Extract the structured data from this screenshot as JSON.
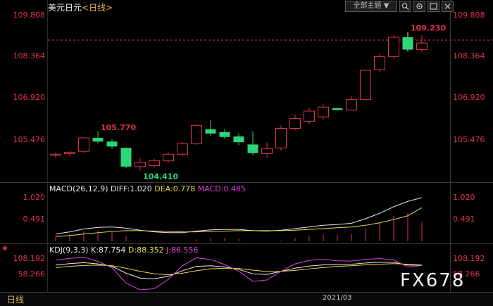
{
  "header": {
    "symbol": "美元日元",
    "period": "<日线>",
    "theme_button": "全部主题",
    "theme_arrow": "▼",
    "icons": [
      "search-icon",
      "settings-icon",
      "fullscreen-icon",
      "close-icon"
    ]
  },
  "footer": {
    "period_tab": "日线",
    "date_label": "2021/03",
    "watermark": "FX678"
  },
  "chart_data": [
    {
      "type": "candlestick",
      "title": "美元日元<日线>",
      "ylim": [
        104.0,
        110.2
      ],
      "yticks": [
        "109.808",
        "108.364",
        "106.920",
        "105.476"
      ],
      "ytick_values": [
        109.808,
        108.364,
        106.92,
        105.476
      ],
      "reference_line": 108.95,
      "annotations": [
        {
          "text": "109.230",
          "value": 109.23,
          "index": 25
        },
        {
          "text": "105.770",
          "value": 105.77,
          "index": 3
        },
        {
          "text": "104.410",
          "value": 104.41,
          "index": 6
        }
      ],
      "candles": [
        {
          "o": 104.95,
          "h": 105.05,
          "l": 104.85,
          "c": 104.98
        },
        {
          "o": 105.0,
          "h": 105.08,
          "l": 104.92,
          "c": 105.05
        },
        {
          "o": 105.08,
          "h": 105.55,
          "l": 105.02,
          "c": 105.55
        },
        {
          "o": 105.55,
          "h": 105.77,
          "l": 105.35,
          "c": 105.42
        },
        {
          "o": 105.42,
          "h": 105.5,
          "l": 105.18,
          "c": 105.25
        },
        {
          "o": 105.2,
          "h": 105.22,
          "l": 104.5,
          "c": 104.55
        },
        {
          "o": 104.55,
          "h": 104.85,
          "l": 104.41,
          "c": 104.7
        },
        {
          "o": 104.58,
          "h": 104.82,
          "l": 104.52,
          "c": 104.75
        },
        {
          "o": 104.75,
          "h": 105.05,
          "l": 104.68,
          "c": 104.98
        },
        {
          "o": 104.98,
          "h": 105.4,
          "l": 104.92,
          "c": 105.35
        },
        {
          "o": 105.35,
          "h": 106.02,
          "l": 105.3,
          "c": 105.98
        },
        {
          "o": 105.85,
          "h": 106.18,
          "l": 105.62,
          "c": 105.7
        },
        {
          "o": 105.75,
          "h": 105.85,
          "l": 105.5,
          "c": 105.58
        },
        {
          "o": 105.6,
          "h": 105.7,
          "l": 105.3,
          "c": 105.4
        },
        {
          "o": 105.32,
          "h": 105.78,
          "l": 104.95,
          "c": 105.02
        },
        {
          "o": 105.0,
          "h": 105.4,
          "l": 104.88,
          "c": 105.18
        },
        {
          "o": 105.2,
          "h": 105.98,
          "l": 105.12,
          "c": 105.88
        },
        {
          "o": 105.88,
          "h": 106.35,
          "l": 105.82,
          "c": 106.22
        },
        {
          "o": 106.12,
          "h": 106.6,
          "l": 106.02,
          "c": 106.48
        },
        {
          "o": 106.28,
          "h": 106.72,
          "l": 106.18,
          "c": 106.62
        },
        {
          "o": 106.58,
          "h": 106.6,
          "l": 106.5,
          "c": 106.52
        },
        {
          "o": 106.52,
          "h": 107.0,
          "l": 106.5,
          "c": 106.88
        },
        {
          "o": 106.88,
          "h": 107.92,
          "l": 106.85,
          "c": 107.9
        },
        {
          "o": 107.92,
          "h": 108.48,
          "l": 107.82,
          "c": 108.38
        },
        {
          "o": 108.38,
          "h": 109.12,
          "l": 108.3,
          "c": 109.05
        },
        {
          "o": 109.05,
          "h": 109.23,
          "l": 108.55,
          "c": 108.62
        },
        {
          "o": 108.62,
          "h": 109.12,
          "l": 108.55,
          "c": 108.85
        }
      ]
    },
    {
      "type": "line",
      "title": "MACD(26,12,9)",
      "legend": [
        {
          "label": "DIFF:1.020",
          "color": "#e8e8e8"
        },
        {
          "label": "DEA:0.778",
          "color": "#e8d84a"
        },
        {
          "label": "MACD:0.485",
          "color": "#e040e0"
        }
      ],
      "ylim": [
        0.0,
        1.1
      ],
      "yticks": [
        "1.020",
        "0.491"
      ],
      "ytick_values": [
        1.02,
        0.491
      ],
      "series": [
        {
          "name": "DIFF",
          "color": "#e8e8e8",
          "values": [
            0.14,
            0.19,
            0.26,
            0.3,
            0.31,
            0.28,
            0.23,
            0.19,
            0.17,
            0.17,
            0.21,
            0.24,
            0.25,
            0.25,
            0.22,
            0.21,
            0.23,
            0.27,
            0.31,
            0.35,
            0.37,
            0.4,
            0.51,
            0.64,
            0.8,
            0.93,
            1.02
          ]
        },
        {
          "name": "DEA",
          "color": "#e8d84a",
          "values": [
            0.08,
            0.1,
            0.14,
            0.17,
            0.2,
            0.22,
            0.22,
            0.21,
            0.2,
            0.19,
            0.19,
            0.2,
            0.21,
            0.22,
            0.22,
            0.22,
            0.22,
            0.23,
            0.25,
            0.27,
            0.29,
            0.31,
            0.35,
            0.41,
            0.49,
            0.58,
            0.778
          ]
        }
      ],
      "histogram": [
        0.12,
        0.18,
        0.24,
        0.26,
        0.22,
        0.12,
        0.02,
        0.0,
        0.0,
        0.0,
        0.04,
        0.08,
        0.08,
        0.06,
        0.0,
        0.0,
        0.02,
        0.08,
        0.12,
        0.16,
        0.16,
        0.18,
        0.32,
        0.46,
        0.62,
        0.7,
        0.485
      ]
    },
    {
      "type": "line",
      "title": "KDJ(9,3,3)",
      "legend": [
        {
          "label": "K:87.754",
          "color": "#e8e8e8"
        },
        {
          "label": "D:88.352",
          "color": "#e8d84a"
        },
        {
          "label": "J:86.556",
          "color": "#e040e0"
        }
      ],
      "ylim": [
        20,
        120
      ],
      "yticks": [
        "108.192",
        "58.266"
      ],
      "ytick_values": [
        108.192,
        58.266
      ],
      "series": [
        {
          "name": "K",
          "color": "#e8e8e8",
          "values": [
            88,
            93,
            96,
            92,
            84,
            62,
            46,
            44,
            52,
            70,
            84,
            86,
            82,
            74,
            60,
            58,
            68,
            78,
            85,
            89,
            90,
            91,
            95,
            97,
            97,
            88,
            87.754
          ]
        },
        {
          "name": "D",
          "color": "#e8d84a",
          "values": [
            80,
            84,
            87,
            88,
            86,
            78,
            68,
            60,
            57,
            62,
            70,
            76,
            78,
            77,
            72,
            67,
            68,
            71,
            76,
            80,
            84,
            86,
            89,
            91,
            93,
            91,
            88.352
          ]
        },
        {
          "name": "J",
          "color": "#e040e0",
          "values": [
            104,
            110,
            114,
            100,
            80,
            30,
            4,
            12,
            42,
            86,
            112,
            106,
            90,
            68,
            36,
            40,
            68,
            92,
            103,
            107,
            102,
            101,
            107,
            109,
            105,
            82,
            86.556
          ]
        }
      ]
    }
  ]
}
